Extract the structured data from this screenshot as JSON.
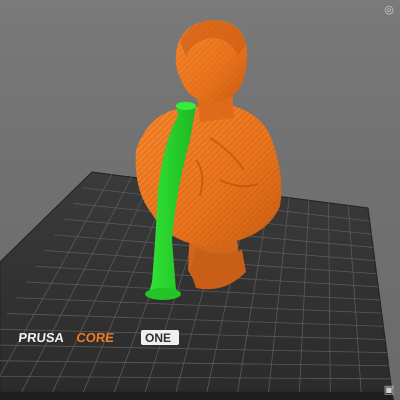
{
  "viewport": {
    "background_color": "#727272",
    "bed": {
      "brand": "PRUSA",
      "model_word": "CORE",
      "model_badge": "ONE",
      "surface_color": "#2f2f2f",
      "grid_color": "#5a5a5a",
      "brand_color": "#f0f0f0",
      "model_color": "#f27c21"
    },
    "objects": [
      {
        "name": "bust-model",
        "color": "#f07a22",
        "selected": false
      },
      {
        "name": "support-pillar",
        "color": "#29d12b",
        "selected": true
      }
    ]
  },
  "icons": {
    "top_right": "gizmo-icon",
    "bottom_right": "view-cube-icon"
  }
}
